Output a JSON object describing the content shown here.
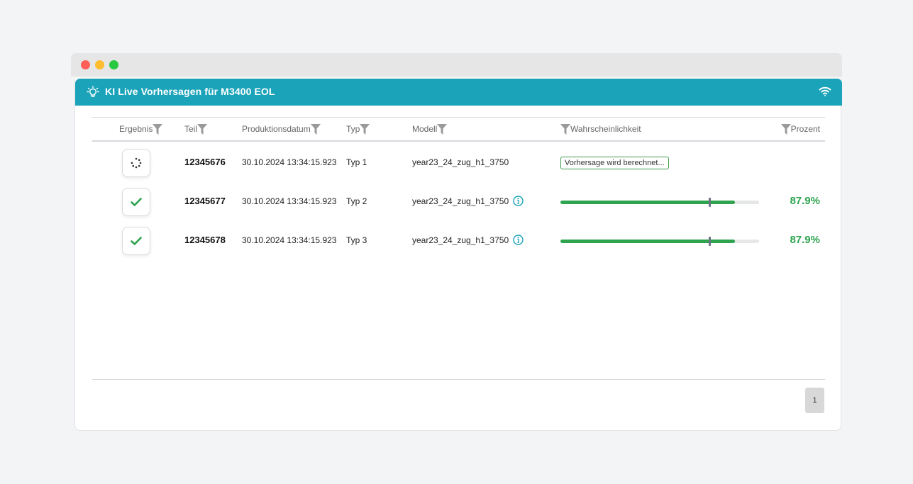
{
  "header": {
    "title": "KI Live Vorhersagen für M3400 EOL",
    "icon": "lightbulb-icon",
    "status_icon": "wifi-icon"
  },
  "table": {
    "columns": {
      "ergebnis": "Ergebnis",
      "teil": "Teil",
      "produktionsdatum": "Produktionsdatum",
      "typ": "Typ",
      "modell": "Modell",
      "wahrscheinlichkeit": "Wahrscheinlichkeit",
      "prozent": "Prozent"
    },
    "rows": [
      {
        "status": "loading",
        "teil": "12345676",
        "datum": "30.10.2024 13:34:15.923",
        "typ": "Typ 1",
        "modell": "year23_24_zug_h1_3750",
        "badge": "Vorhersage wird berechnet...",
        "probability": null,
        "threshold": null,
        "prozent": ""
      },
      {
        "status": "ok",
        "teil": "12345677",
        "datum": "30.10.2024 13:34:15.923",
        "typ": "Typ 2",
        "modell": "year23_24_zug_h1_3750",
        "badge": "",
        "probability": 0.879,
        "threshold": 0.75,
        "prozent": "87.9%"
      },
      {
        "status": "ok",
        "teil": "12345678",
        "datum": "30.10.2024 13:34:15.923",
        "typ": "Typ 3",
        "modell": "year23_24_zug_h1_3750",
        "badge": "",
        "probability": 0.879,
        "threshold": 0.75,
        "prozent": "87.9%"
      }
    ]
  },
  "pagination": {
    "current_page": "1"
  },
  "colors": {
    "header": "#1aa3b9",
    "success": "#2ea44f",
    "marker": "#6b7280",
    "info": "#1aa3b9"
  }
}
